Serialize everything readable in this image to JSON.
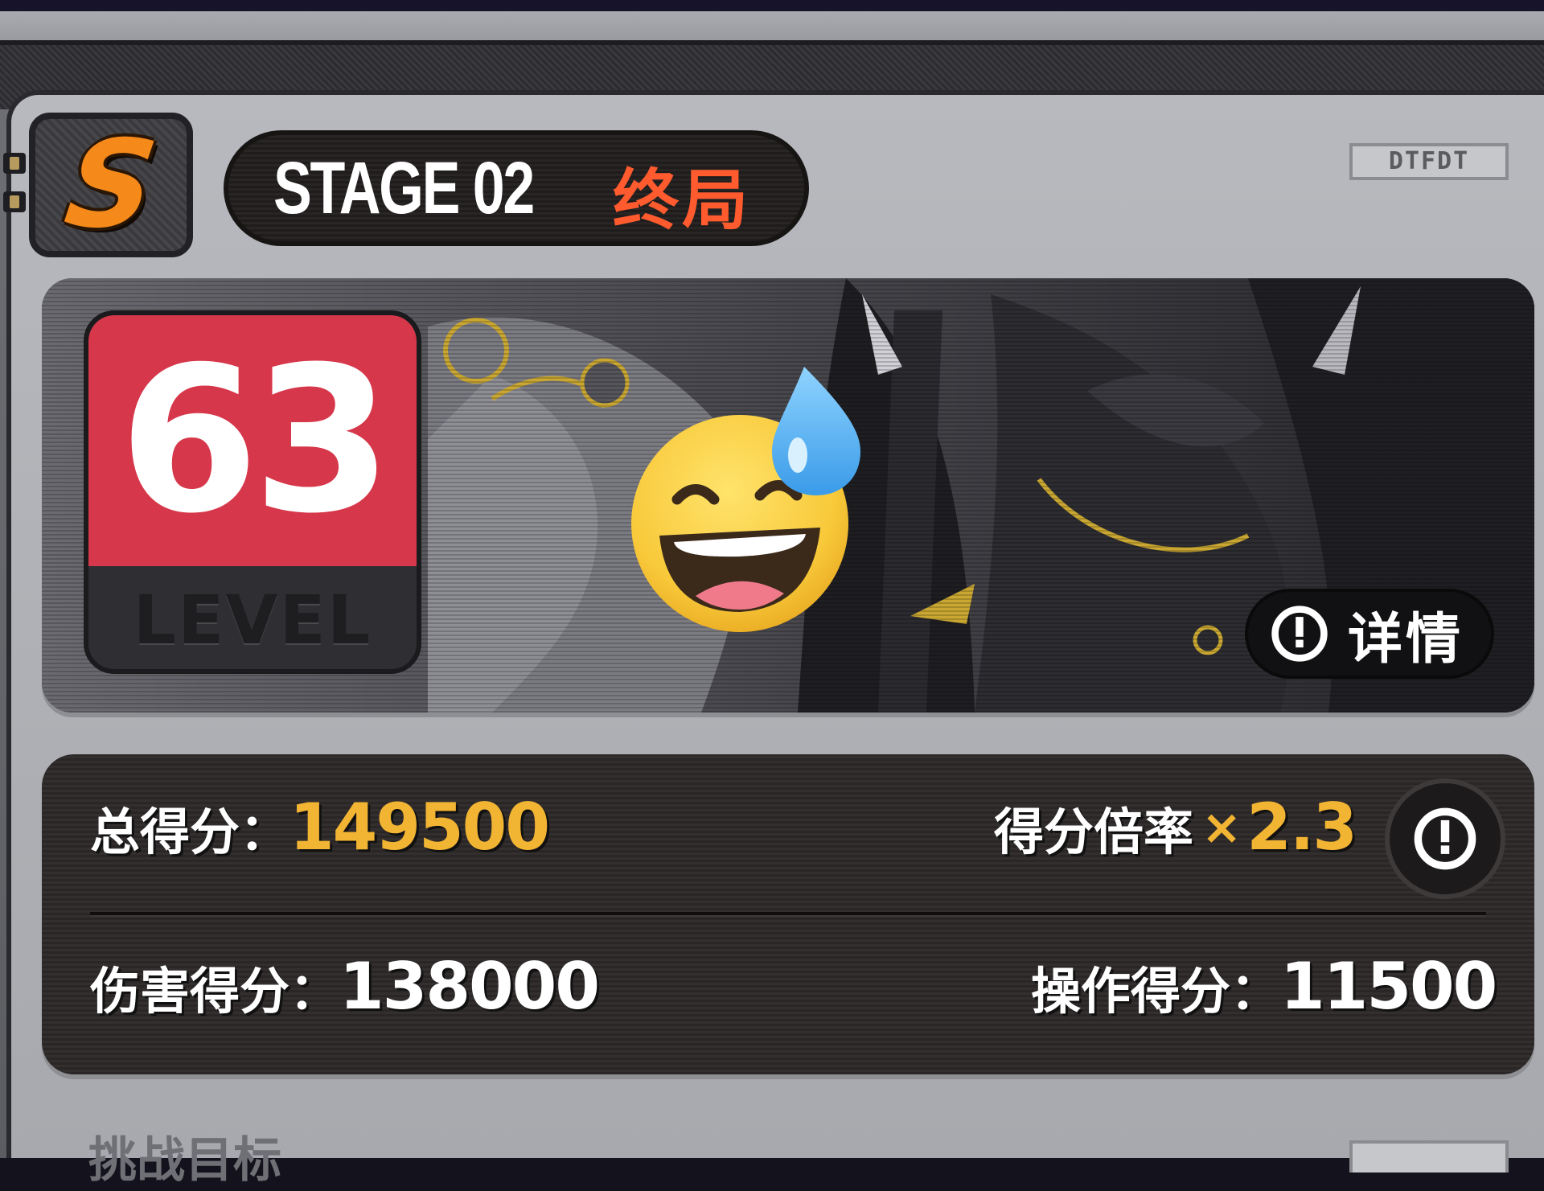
{
  "header": {
    "rank": "S",
    "stage_label": "STAGE 02",
    "stage_name": "终局",
    "code_tag": "DTFDT"
  },
  "banner": {
    "level_number": "63",
    "level_label": "LEVEL",
    "overlay_emoji": "grinning-face-with-sweat",
    "details_label": "详情"
  },
  "scores": {
    "total_label": "总得分：",
    "total_value": "149500",
    "multiplier_label": "得分倍率",
    "multiplier_symbol": "×",
    "multiplier_value": "2.3",
    "damage_label": "伤害得分：",
    "damage_value": "138000",
    "operation_label": "操作得分：",
    "operation_value": "11500"
  },
  "next_section": {
    "title": "挑战目标"
  },
  "colors": {
    "rank_orange": "#f58a1a",
    "stage_name_red": "#ff5b2e",
    "level_red": "#d6374a",
    "score_gold": "#f2b433"
  },
  "icons": [
    "clock-icon",
    "grinning-sweat-emoji"
  ]
}
